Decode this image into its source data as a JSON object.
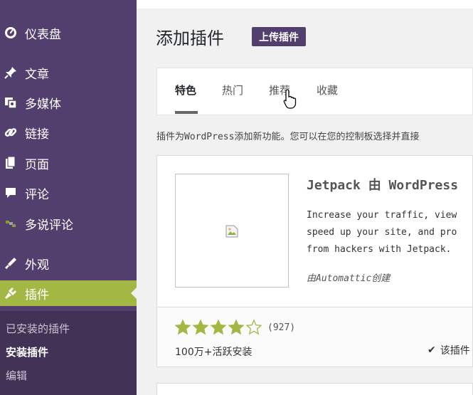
{
  "sidebar": {
    "items": [
      {
        "label": "仪表盘",
        "icon": "dashboard-icon"
      },
      {
        "label": "文章",
        "icon": "pin-icon"
      },
      {
        "label": "多媒体",
        "icon": "media-icon"
      },
      {
        "label": "链接",
        "icon": "link-icon"
      },
      {
        "label": "页面",
        "icon": "pages-icon"
      },
      {
        "label": "评论",
        "icon": "comment-icon"
      },
      {
        "label": "多说评论",
        "icon": "duoshuo-icon"
      },
      {
        "label": "外观",
        "icon": "appearance-icon"
      },
      {
        "label": "插件",
        "icon": "plugins-icon"
      }
    ],
    "submenu": [
      {
        "label": "已安装的插件"
      },
      {
        "label": "安装插件"
      },
      {
        "label": "编辑"
      }
    ]
  },
  "main": {
    "title": "添加插件",
    "upload_button": "上传插件",
    "tabs": [
      {
        "label": "特色"
      },
      {
        "label": "热门"
      },
      {
        "label": "推荐"
      },
      {
        "label": "收藏"
      }
    ],
    "description": "插件为WordPress添加新功能。您可以在您的控制板选择并直接",
    "plugin": {
      "name": "Jetpack 由 WordPress",
      "desc_lines": [
        "Increase your traffic, view",
        "speed up your site, and pro",
        "from hackers with Jetpack."
      ],
      "author": "由Automattic创建",
      "rating_count": "(927)",
      "stars_filled": 4,
      "stars_total": 5,
      "installs": "100万+活跃安装",
      "compat": "该插件"
    }
  },
  "colors": {
    "sidebar_bg": "#523f6d",
    "active_item": "#a3b745",
    "star": "#a3b745"
  }
}
